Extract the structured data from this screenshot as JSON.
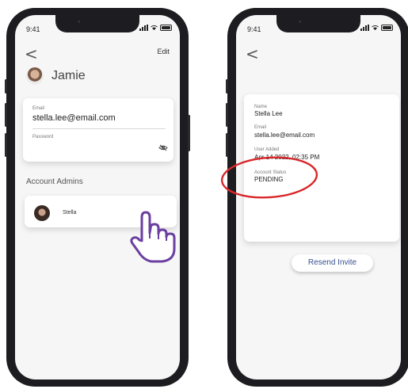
{
  "left_screen": {
    "status": {
      "time": "9:41"
    },
    "header": {
      "back_label": "<",
      "edit_label": "Edit"
    },
    "profile": {
      "name": "Jamie"
    },
    "credentials": {
      "email_label": "Email",
      "email_value": "stella.lee@email.com",
      "password_label": "Password",
      "password_icon": "eye-slash-icon"
    },
    "admins": {
      "title": "Account Admins",
      "items": [
        {
          "name": "Stella"
        }
      ]
    }
  },
  "right_screen": {
    "status": {
      "time": "9:41"
    },
    "header": {
      "back_label": "<"
    },
    "details": {
      "name_label": "Name",
      "name_value": "Stella Lee",
      "email_label": "Email",
      "email_value": "stella.lee@email.com",
      "added_label": "User Added",
      "added_value": "Apr 14 2022, 02:35 PM",
      "status_label": "Account Status",
      "status_value": "PENDING"
    },
    "resend_label": "Resend Invite"
  },
  "colors": {
    "phone_frame": "#1d1d21",
    "screen_bg": "#f6f6f7",
    "annotation": "#d9262a",
    "hand_pointer": "#6b3fa0",
    "button_text": "#35508f"
  }
}
